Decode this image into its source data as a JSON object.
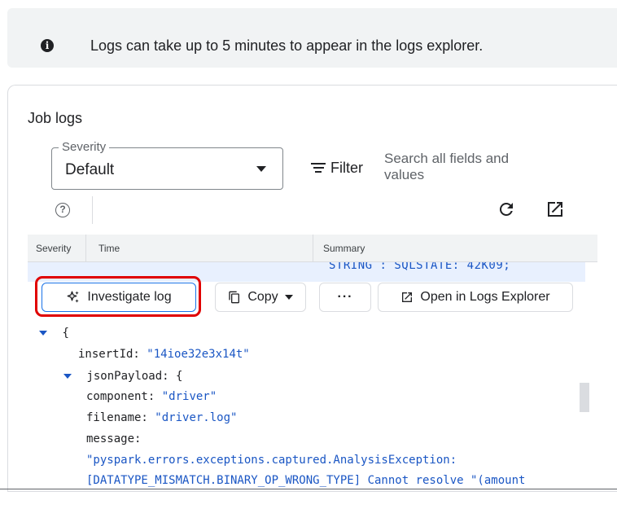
{
  "banner": {
    "icon": "info-icon",
    "text": "Logs can take up to 5 minutes to appear in the logs explorer."
  },
  "card": {
    "title": "Job logs",
    "severity": {
      "label": "Severity",
      "value": "Default"
    },
    "filter_label": "Filter",
    "search_placeholder": "Search all fields and values",
    "table_headers": [
      "Severity",
      "Time",
      "Summary"
    ],
    "truncated_line": "STRING : SQLSTATE: 42K09;",
    "actions": {
      "investigate": "Investigate log",
      "copy": "Copy",
      "more": "···",
      "open_logs": "Open in Logs Explorer"
    },
    "log_lines": {
      "open_brace": "{",
      "insert_key": "insertId:",
      "insert_val": "\"14ioe32e3x14t\"",
      "json_key": "jsonPayload:",
      "json_brace": "{",
      "component_key": "component:",
      "component_val": "\"driver\"",
      "filename_key": "filename:",
      "filename_val": "\"driver.log\"",
      "message_key": "message:",
      "message_val_1": "\"pyspark.errors.exceptions.captured.AnalysisException:",
      "message_val_2": "[DATATYPE_MISMATCH.BINARY_OP_WRONG_TYPE] Cannot resolve \"(amount"
    }
  }
}
